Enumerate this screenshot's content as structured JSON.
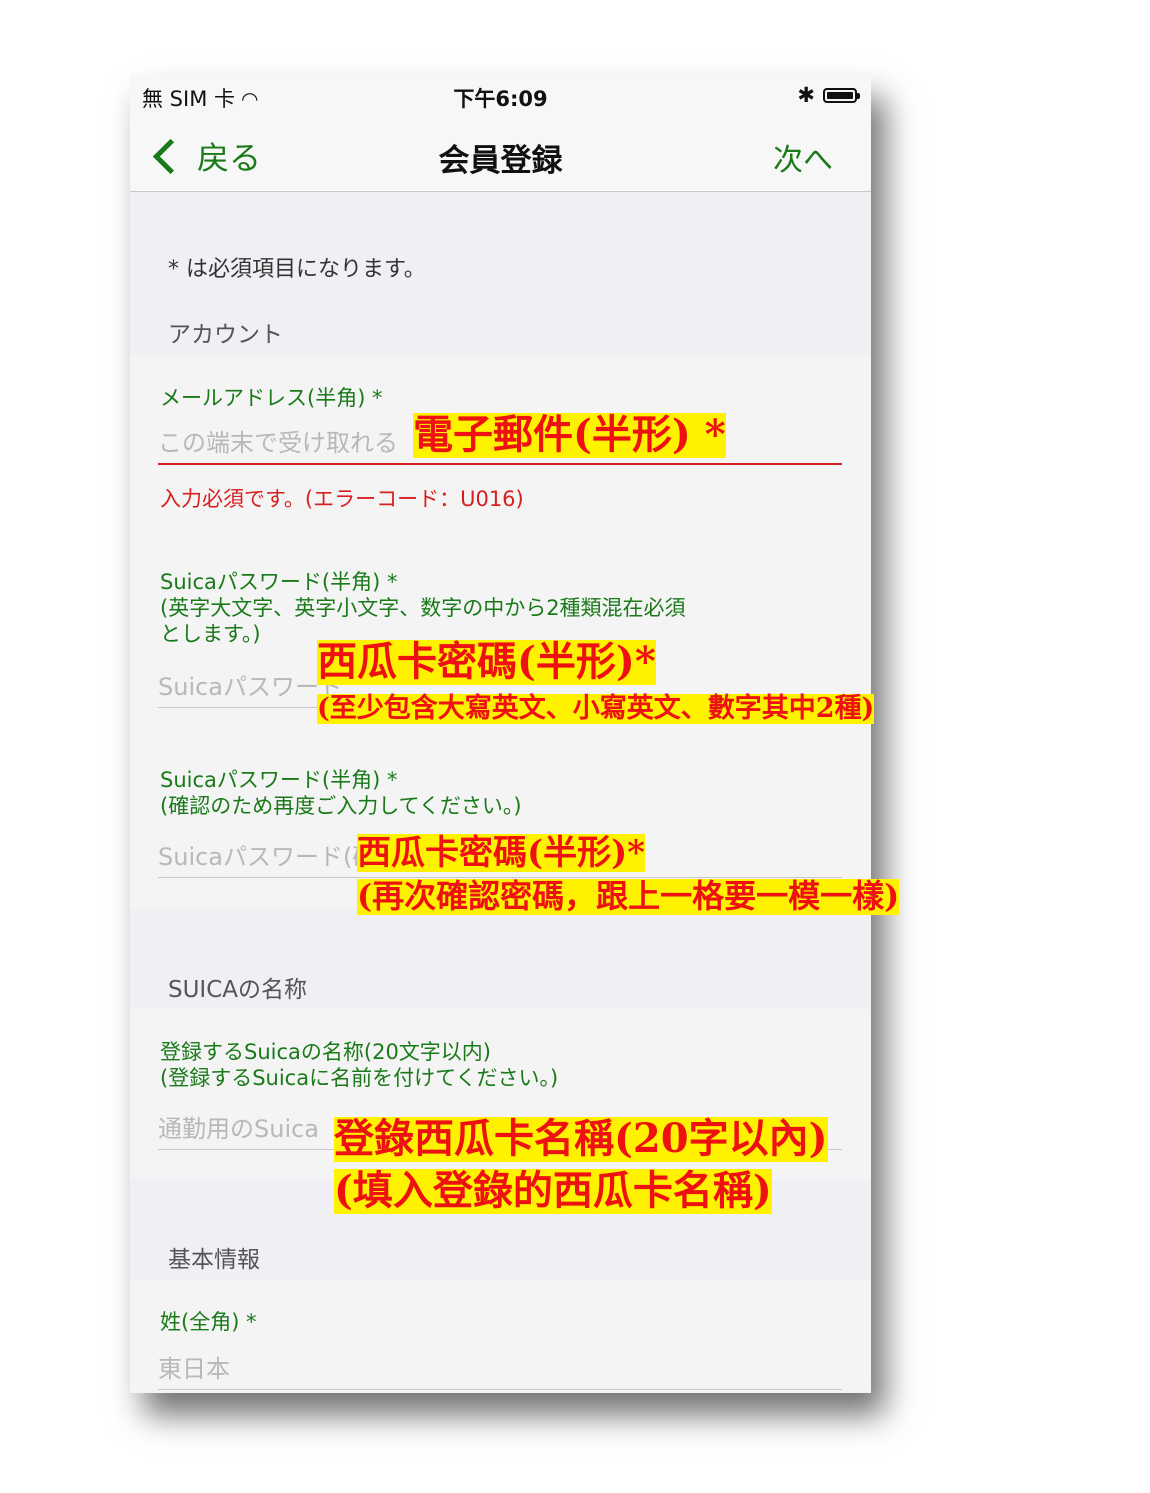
{
  "status_bar": {
    "carrier": "無 SIM 卡",
    "time": "下午6:09",
    "bluetooth": "✱"
  },
  "nav": {
    "back_label": "戻る",
    "title": "会員登録",
    "next_label": "次へ"
  },
  "required_note": "* は必須項目になります。",
  "account": {
    "header": "アカウント",
    "email": {
      "label": "メールアドレス(半角) *",
      "placeholder": "この端末で受け取れる",
      "error": "入力必須です。(エラーコード：U016)"
    },
    "password": {
      "label_line1": "Suicaパスワード(半角) *",
      "label_line2": "(英字大文字、英字小文字、数字の中から2種類混在必須",
      "label_line3": "とします。)",
      "placeholder": "Suicaパスワード"
    },
    "password_confirm": {
      "label_line1": "Suicaパスワード(半角) *",
      "label_line2": "(確認のため再度ご入力してください。)",
      "placeholder": "Suicaパスワード(確認)"
    }
  },
  "suica_name": {
    "header": "SUICAの名称",
    "label_line1": "登録するSuicaの名称(20文字以内)",
    "label_line2": "(登録するSuicaに名前を付けてください。)",
    "placeholder": "通勤用のSuica"
  },
  "basic_info": {
    "header": "基本情報",
    "surname": {
      "label": "姓(全角) *",
      "placeholder": "東日本"
    }
  },
  "annotations": {
    "email": "電子郵件(半形) *",
    "password_line1": "西瓜卡密碼(半形)*",
    "password_line2": "(至少包含大寫英文、小寫英文、數字其中2種)",
    "confirm_line1": "西瓜卡密碼(半形)*",
    "confirm_line2": "(再次確認密碼，跟上一格要一模一樣)",
    "name_line1": "登錄西瓜卡名稱(20字以內)",
    "name_line2": "(填入登錄的西瓜卡名稱)"
  },
  "colors": {
    "accent_green": "#1a7a1a",
    "error_red": "#d82020",
    "highlight_yellow": "#fff200",
    "annotation_red": "#ee1111"
  }
}
